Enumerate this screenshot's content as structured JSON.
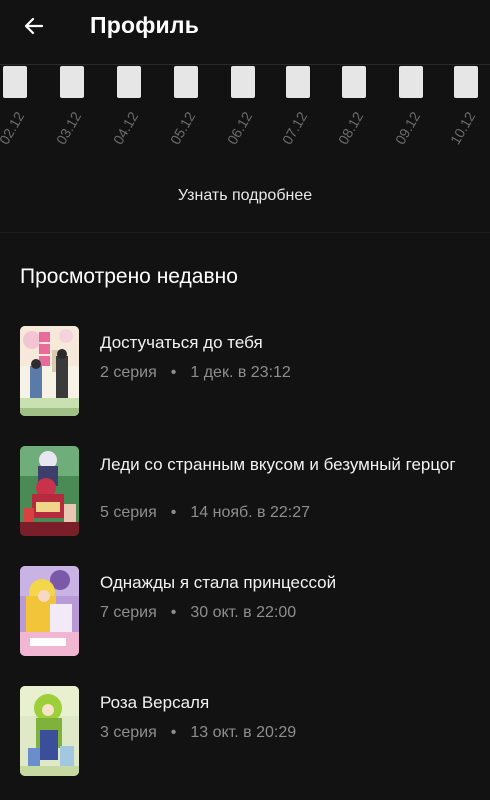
{
  "header": {
    "title": "Профиль"
  },
  "calendar": {
    "dates": [
      "02.12",
      "03.12",
      "04.12",
      "05.12",
      "06.12",
      "07.12",
      "08.12",
      "09.12",
      "10.12"
    ]
  },
  "more_link": "Узнать подробнее",
  "recent": {
    "title": "Просмотрено недавно",
    "items": [
      {
        "title": "Достучаться до тебя",
        "episode": "2 серия",
        "date": "1 дек. в 23:12"
      },
      {
        "title": "Леди со странным вкусом и безумный герцог",
        "episode": "5 серия",
        "date": "14 нояб. в 22:27"
      },
      {
        "title": "Однажды я стала принцессой",
        "episode": "7 серия",
        "date": "30 окт. в 22:00"
      },
      {
        "title": "Роза Версаля",
        "episode": "3 серия",
        "date": "13 окт. в 20:29"
      }
    ],
    "separator": "•"
  }
}
